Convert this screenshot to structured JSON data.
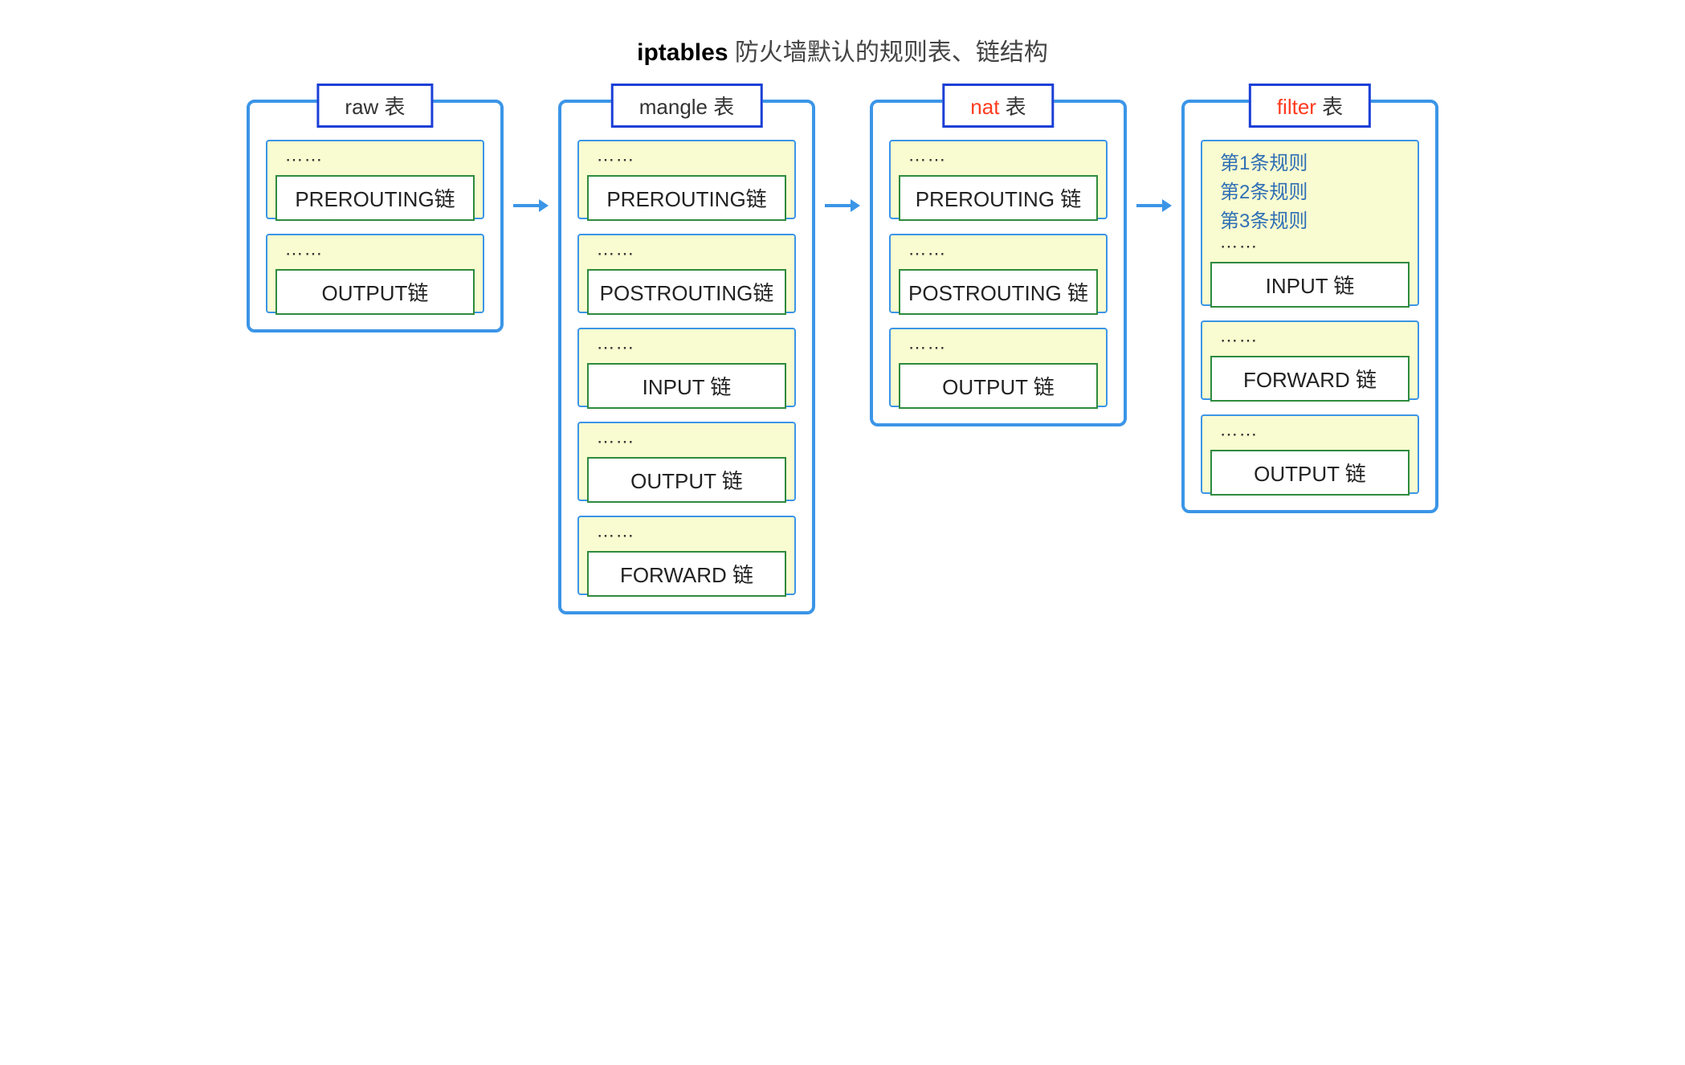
{
  "title_bold": "iptables",
  "title_rest": " 防火墙默认的规则表、链结构",
  "ellipsis": "⋯⋯",
  "tables": [
    {
      "id": "raw",
      "label_prefix": "raw",
      "label_suffix": " 表",
      "highlight": false,
      "chains": [
        {
          "name": "PREROUTING链",
          "rules": []
        },
        {
          "name": "OUTPUT链",
          "rules": []
        }
      ]
    },
    {
      "id": "mangle",
      "label_prefix": "mangle",
      "label_suffix": " 表",
      "highlight": false,
      "chains": [
        {
          "name": "PREROUTING链",
          "rules": []
        },
        {
          "name": "POSTROUTING链",
          "rules": []
        },
        {
          "name": "INPUT 链",
          "rules": []
        },
        {
          "name": "OUTPUT 链",
          "rules": []
        },
        {
          "name": "FORWARD 链",
          "rules": []
        }
      ]
    },
    {
      "id": "nat",
      "label_prefix": "nat",
      "label_suffix": " 表",
      "highlight": true,
      "chains": [
        {
          "name": "PREROUTING 链",
          "rules": []
        },
        {
          "name": "POSTROUTING 链",
          "rules": []
        },
        {
          "name": "OUTPUT 链",
          "rules": []
        }
      ]
    },
    {
      "id": "filter",
      "label_prefix": "filter",
      "label_suffix": " 表",
      "highlight": true,
      "chains": [
        {
          "name": "INPUT 链",
          "rules": [
            "第1条规则",
            "第2条规则",
            "第3条规则"
          ]
        },
        {
          "name": "FORWARD 链",
          "rules": []
        },
        {
          "name": "OUTPUT 链",
          "rules": []
        }
      ]
    }
  ]
}
